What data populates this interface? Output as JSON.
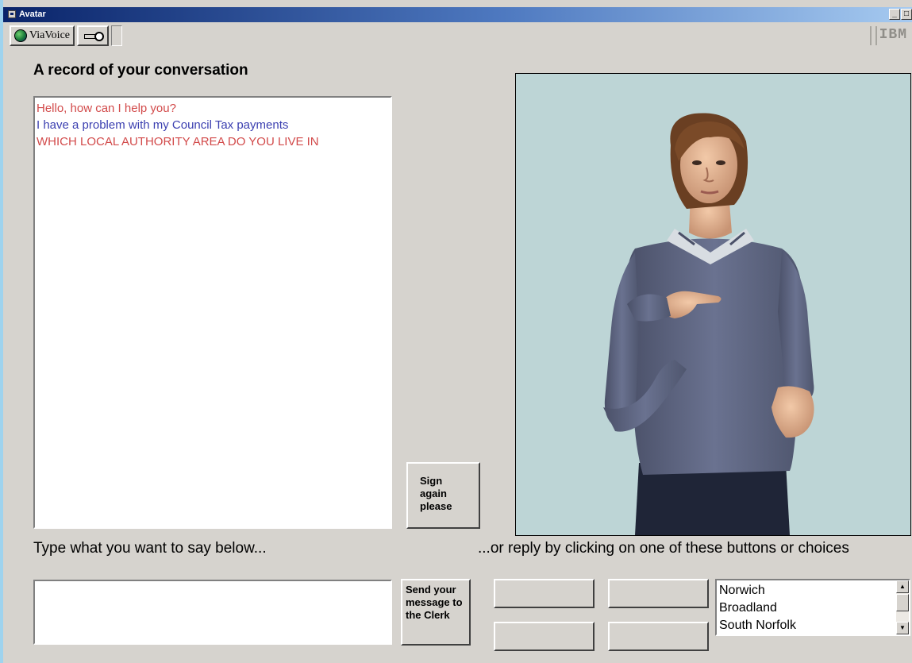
{
  "window": {
    "title": "Avatar",
    "minimize_symbol": "_",
    "maximize_symbol": "□"
  },
  "toolbar": {
    "viavoice_label": "ViaVoice",
    "brand_text": "IBM"
  },
  "conversation": {
    "heading": "A record of your conversation",
    "messages": [
      {
        "text": "Hello, how can I help you?",
        "color": "#d24a4a"
      },
      {
        "text": "I have a problem with my Council Tax payments",
        "color": "#3b3fb0"
      },
      {
        "text": "WHICH LOCAL AUTHORITY AREA DO YOU LIVE IN",
        "color": "#d24a4a"
      }
    ]
  },
  "buttons": {
    "sign_again": "Sign again please",
    "send": "Send your message to the Clerk"
  },
  "labels": {
    "type_below": "Type what you want to say below...",
    "reply_choices": "...or reply by clicking  on one of these buttons or choices"
  },
  "input": {
    "message_value": ""
  },
  "choices": {
    "options": [
      "Norwich",
      "Broadland",
      "South Norfolk"
    ]
  },
  "colors": {
    "title_bar": "#0a246a",
    "window_bg": "#d6d3ce",
    "avatar_bg": "#bdd5d6"
  }
}
